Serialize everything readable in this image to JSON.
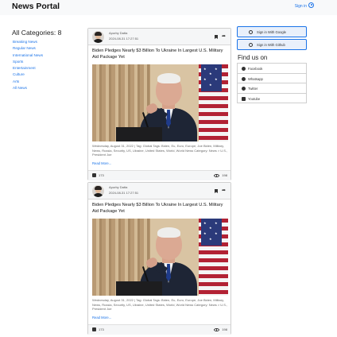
{
  "header": {
    "brand": "News Portal",
    "signin_label": "Sign in"
  },
  "categories": {
    "title": "All Categories: 8",
    "items": [
      "Breaking News",
      "Regular News",
      "International News",
      "Sports",
      "Entertainment",
      "Culture",
      "Arts",
      "All News"
    ]
  },
  "posts": [
    {
      "author": "Apurby Datta",
      "date": "2024-08-31 17:27:51",
      "headline": "Biden Pledges Nearly $3 Billion To Ukraine In Largest U.S. Military Aid Package Yet",
      "tags": "Wednesday, August 31, 2022 | Tag: Global Tags: Biden, Eu, Euro, Europe, Joe Biden, Military, News, Russia, Security, US, Ukraine, United States, World, World News Category: News > U.S., President Joe",
      "read_more": "Read More...",
      "likes": "173",
      "views": "198"
    },
    {
      "author": "Apurby Datta",
      "date": "2024-08-31 17:27:51",
      "headline": "Biden Pledges Nearly $3 Billion To Ukraine In Largest U.S. Military Aid Package Yet",
      "tags": "Wednesday, August 31, 2022 | Tag: Global Tags: Biden, Eu, Euro, Europe, Joe Biden, Military, News, Russia, Security, US, Ukraine, United States, World, World News Category: News > U.S., President Joe",
      "read_more": "Read More...",
      "likes": "173",
      "views": "198"
    }
  ],
  "auth": {
    "google_label": "Sign in With Google",
    "github_label": "Sign in With Github"
  },
  "find_us": {
    "title": "Find us on",
    "items": [
      "Facebook",
      "Whatsapp",
      "Twitter",
      "Youtube"
    ]
  },
  "colors": {
    "accent": "#1a73e8",
    "header_bg": "#f8f9fa"
  }
}
